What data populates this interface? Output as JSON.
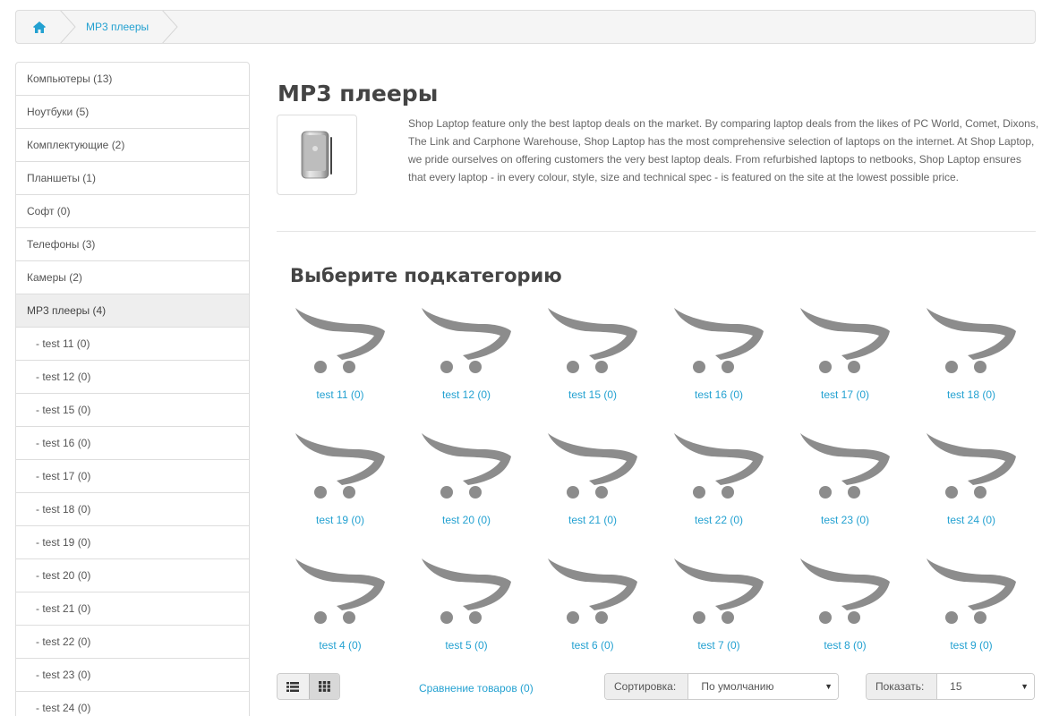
{
  "breadcrumb": {
    "home_icon": "home-icon",
    "current": "MP3 плееры"
  },
  "sidebar": {
    "items": [
      {
        "label": "Компьютеры (13)"
      },
      {
        "label": "Ноутбуки (5)"
      },
      {
        "label": "Комплектующие (2)"
      },
      {
        "label": "Планшеты (1)"
      },
      {
        "label": "Софт (0)"
      },
      {
        "label": "Телефоны (3)"
      },
      {
        "label": "Камеры (2)"
      },
      {
        "label": "MP3 плееры (4)",
        "active": true
      },
      {
        "label": "- test 11 (0)",
        "sub": true
      },
      {
        "label": "- test 12 (0)",
        "sub": true
      },
      {
        "label": "- test 15 (0)",
        "sub": true
      },
      {
        "label": "- test 16 (0)",
        "sub": true
      },
      {
        "label": "- test 17 (0)",
        "sub": true
      },
      {
        "label": "- test 18 (0)",
        "sub": true
      },
      {
        "label": "- test 19 (0)",
        "sub": true
      },
      {
        "label": "- test 20 (0)",
        "sub": true
      },
      {
        "label": "- test 21 (0)",
        "sub": true
      },
      {
        "label": "- test 22 (0)",
        "sub": true
      },
      {
        "label": "- test 23 (0)",
        "sub": true
      },
      {
        "label": "- test 24 (0)",
        "sub": true
      }
    ]
  },
  "main": {
    "title": "MP3 плееры",
    "description": "Shop Laptop feature only the best laptop deals on the market. By comparing laptop deals from the likes of PC World, Comet, Dixons, The Link and Carphone Warehouse, Shop Laptop has the most comprehensive selection of laptops on the internet. At Shop Laptop, we pride ourselves on offering customers the very best laptop deals. From refurbished laptops to netbooks, Shop Laptop ensures that every laptop - in every colour, style, size and technical spec - is featured on the site at the lowest possible price.",
    "subcategory_title": "Выберите подкатегорию",
    "subcategories": [
      "test 11 (0)",
      "test 12 (0)",
      "test 15 (0)",
      "test 16 (0)",
      "test 17 (0)",
      "test 18 (0)",
      "test 19 (0)",
      "test 20 (0)",
      "test 21 (0)",
      "test 22 (0)",
      "test 23 (0)",
      "test 24 (0)",
      "test 4 (0)",
      "test 5 (0)",
      "test 6 (0)",
      "test 7 (0)",
      "test 8 (0)",
      "test 9 (0)"
    ]
  },
  "toolbar": {
    "list_view_icon": "list-view-icon",
    "grid_view_icon": "grid-view-icon",
    "compare_label": "Сравнение товаров (0)",
    "sort_label": "Сортировка:",
    "sort_value": "По умолчанию",
    "limit_label": "Показать:",
    "limit_value": "15"
  },
  "colors": {
    "link": "#23a1d1",
    "placeholder_icon": "#8c8c8c"
  }
}
